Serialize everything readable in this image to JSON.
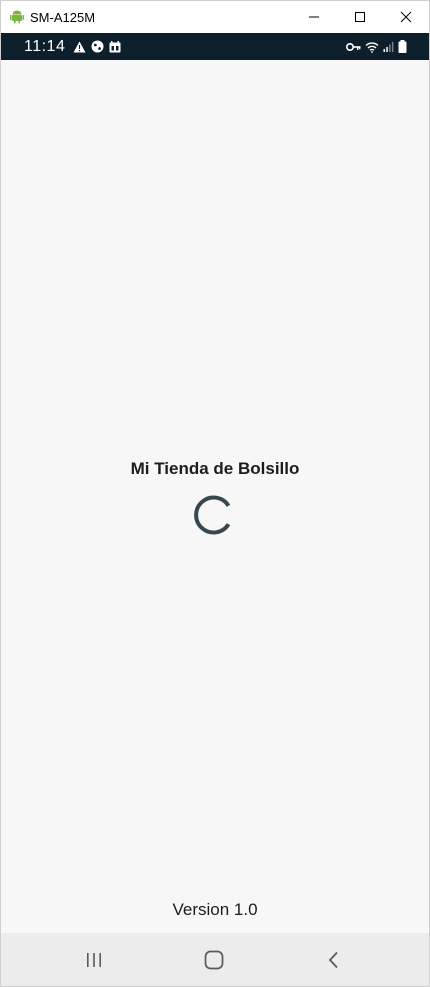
{
  "window": {
    "title": "SM-A125M"
  },
  "status_bar": {
    "time": "11:14",
    "left_icons": [
      "warning-icon",
      "vpn-globe-icon",
      "calendar-icon"
    ],
    "right_icons": [
      "key-icon",
      "wifi-icon",
      "signal-icon",
      "battery-icon"
    ],
    "background": "#0c1f2b"
  },
  "splash": {
    "app_title": "Mi Tienda de Bolsillo",
    "spinner_color": "#37474f",
    "version": "Version 1.0"
  },
  "nav_bar": {
    "buttons": [
      "recent-apps",
      "home",
      "back"
    ]
  }
}
